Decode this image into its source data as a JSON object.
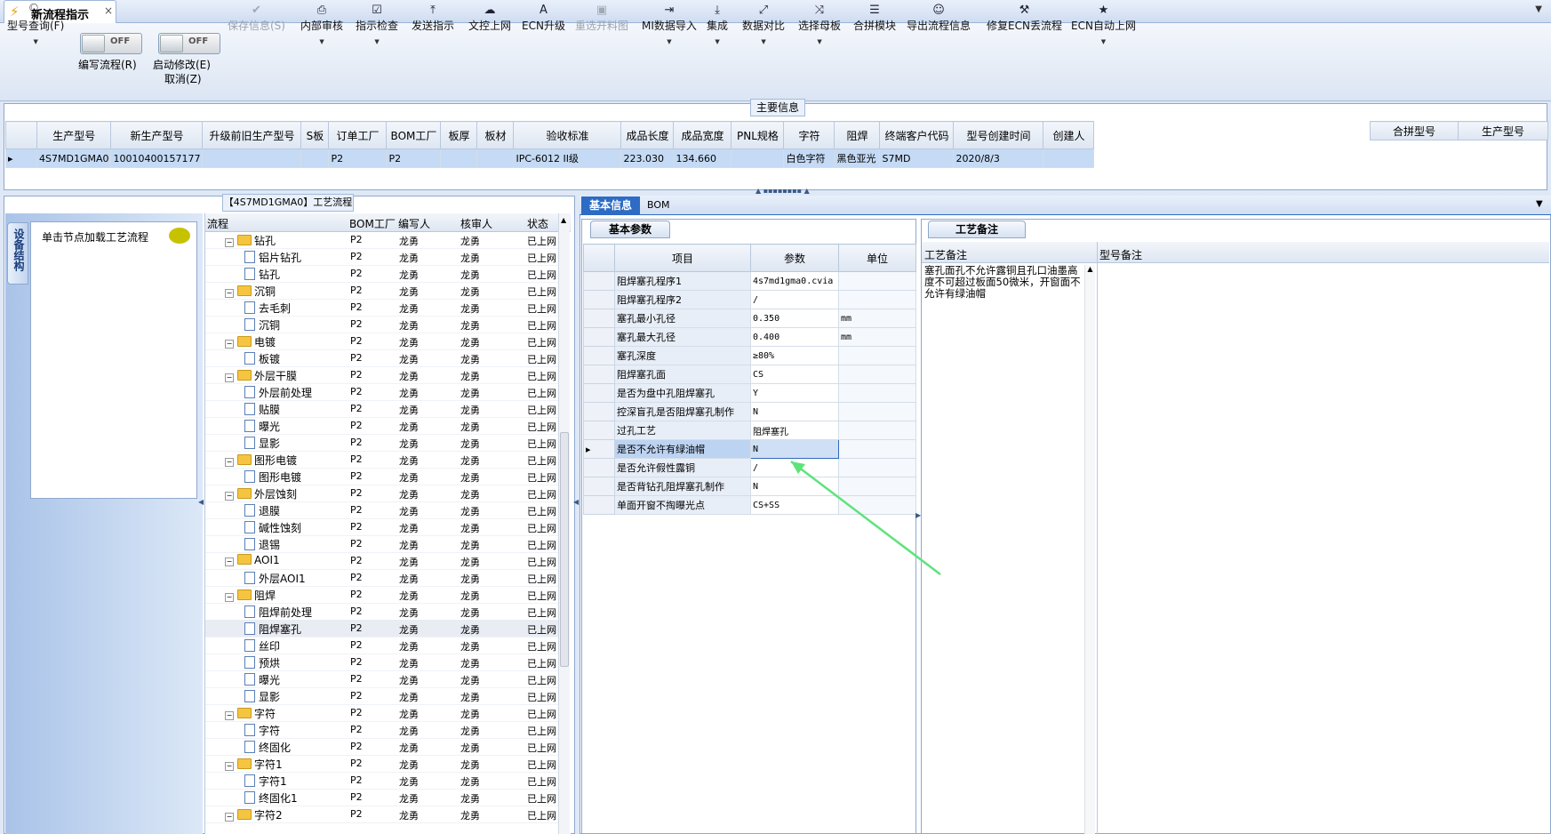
{
  "window": {
    "tab_title": "新流程指示",
    "close": "×"
  },
  "toolbar": {
    "items": [
      {
        "label": "型号查询(F)",
        "icon": "search-icon",
        "glyph": "🔍︎",
        "enabled": true,
        "dropdown": true
      },
      {
        "label": "保存信息(S)",
        "icon": "check-icon",
        "glyph": "✔",
        "enabled": false,
        "dropdown": false
      },
      {
        "label": "内部审核",
        "icon": "print-icon",
        "glyph": "⎙",
        "enabled": true,
        "dropdown": true
      },
      {
        "label": "指示检查",
        "icon": "checklist-icon",
        "glyph": "☑",
        "enabled": true,
        "dropdown": true
      },
      {
        "label": "发送指示",
        "icon": "upload-icon",
        "glyph": "⤒",
        "enabled": true,
        "dropdown": false
      },
      {
        "label": "文控上网",
        "icon": "cloud-icon",
        "glyph": "☁",
        "enabled": true,
        "dropdown": false
      },
      {
        "label": "ECN升级",
        "icon": "ecn-icon",
        "glyph": "A",
        "enabled": true,
        "dropdown": false
      },
      {
        "label": "重选开料图",
        "icon": "image-icon",
        "glyph": "▣",
        "enabled": false,
        "dropdown": false
      },
      {
        "label": "MI数据导入",
        "icon": "import-icon",
        "glyph": "⇥",
        "enabled": true,
        "dropdown": true
      },
      {
        "label": "集成",
        "icon": "download-icon",
        "glyph": "⤓",
        "enabled": true,
        "dropdown": true
      },
      {
        "label": "数据对比",
        "icon": "compare-icon",
        "glyph": "⤢",
        "enabled": true,
        "dropdown": true
      },
      {
        "label": "选择母板",
        "icon": "shuffle-icon",
        "glyph": "⤨",
        "enabled": true,
        "dropdown": true
      },
      {
        "label": "合拼模块",
        "icon": "list-icon",
        "glyph": "☰",
        "enabled": true,
        "dropdown": false
      },
      {
        "label": "导出流程信息",
        "icon": "smile-icon",
        "glyph": "☺",
        "enabled": true,
        "dropdown": false
      },
      {
        "label": "修复ECN丢流程",
        "icon": "wrench-icon",
        "glyph": "⚒",
        "enabled": true,
        "dropdown": false
      },
      {
        "label": "ECN自动上网",
        "icon": "star-icon",
        "glyph": "★",
        "enabled": true,
        "dropdown": true
      }
    ],
    "toggle_write": {
      "state": "OFF",
      "label": "编写流程(R)"
    },
    "toggle_modify": {
      "state": "OFF",
      "label": "启动修改(E)",
      "label2": "取消(Z)"
    }
  },
  "main_info": {
    "title": "主要信息",
    "columns": [
      "生产型号",
      "新生产型号",
      "升级前旧生产型号",
      "S板",
      "订单工厂",
      "BOM工厂",
      "板厚",
      "板材",
      "验收标准",
      "成品长度",
      "成品宽度",
      "PNL规格",
      "字符",
      "阻焊",
      "终端客户代码",
      "型号创建时间",
      "创建人"
    ],
    "row": [
      "4S7MD1GMA0",
      "10010400157177",
      "",
      "",
      "P2",
      "P2",
      "",
      "",
      "IPC-6012 II级",
      "223.030",
      "134.660",
      "",
      "白色字符",
      "黑色亚光",
      "S7MD",
      "2020/8/3",
      ""
    ],
    "merge_columns": [
      "合拼型号",
      "生产型号"
    ]
  },
  "process": {
    "title": "【4S7MD1GMA0】工艺流程",
    "side_tab": "设备结构",
    "load_hint": "单击节点加载工艺流程",
    "columns": [
      "流程",
      "BOM工厂",
      "编写人",
      "核审人",
      "状态"
    ],
    "rows": [
      {
        "name": "钻孔",
        "type": "folder",
        "bom": "P2",
        "writer": "龙勇",
        "reviewer": "龙勇",
        "status": "已上网"
      },
      {
        "name": "铝片钻孔",
        "type": "doc",
        "bom": "P2",
        "writer": "龙勇",
        "reviewer": "龙勇",
        "status": "已上网"
      },
      {
        "name": "钻孔",
        "type": "doc",
        "bom": "P2",
        "writer": "龙勇",
        "reviewer": "龙勇",
        "status": "已上网"
      },
      {
        "name": "沉铜",
        "type": "folder",
        "bom": "P2",
        "writer": "龙勇",
        "reviewer": "龙勇",
        "status": "已上网"
      },
      {
        "name": "去毛刺",
        "type": "doc",
        "bom": "P2",
        "writer": "龙勇",
        "reviewer": "龙勇",
        "status": "已上网"
      },
      {
        "name": "沉铜",
        "type": "doc",
        "bom": "P2",
        "writer": "龙勇",
        "reviewer": "龙勇",
        "status": "已上网"
      },
      {
        "name": "电镀",
        "type": "folder",
        "bom": "P2",
        "writer": "龙勇",
        "reviewer": "龙勇",
        "status": "已上网"
      },
      {
        "name": "板镀",
        "type": "doc",
        "bom": "P2",
        "writer": "龙勇",
        "reviewer": "龙勇",
        "status": "已上网"
      },
      {
        "name": "外层干膜",
        "type": "folder",
        "bom": "P2",
        "writer": "龙勇",
        "reviewer": "龙勇",
        "status": "已上网"
      },
      {
        "name": "外层前处理",
        "type": "doc",
        "bom": "P2",
        "writer": "龙勇",
        "reviewer": "龙勇",
        "status": "已上网"
      },
      {
        "name": "贴膜",
        "type": "doc",
        "bom": "P2",
        "writer": "龙勇",
        "reviewer": "龙勇",
        "status": "已上网"
      },
      {
        "name": "曝光",
        "type": "doc",
        "bom": "P2",
        "writer": "龙勇",
        "reviewer": "龙勇",
        "status": "已上网"
      },
      {
        "name": "显影",
        "type": "doc",
        "bom": "P2",
        "writer": "龙勇",
        "reviewer": "龙勇",
        "status": "已上网"
      },
      {
        "name": "图形电镀",
        "type": "folder",
        "bom": "P2",
        "writer": "龙勇",
        "reviewer": "龙勇",
        "status": "已上网"
      },
      {
        "name": "图形电镀",
        "type": "doc",
        "bom": "P2",
        "writer": "龙勇",
        "reviewer": "龙勇",
        "status": "已上网"
      },
      {
        "name": "外层蚀刻",
        "type": "folder",
        "bom": "P2",
        "writer": "龙勇",
        "reviewer": "龙勇",
        "status": "已上网"
      },
      {
        "name": "退膜",
        "type": "doc",
        "bom": "P2",
        "writer": "龙勇",
        "reviewer": "龙勇",
        "status": "已上网"
      },
      {
        "name": "碱性蚀刻",
        "type": "doc",
        "bom": "P2",
        "writer": "龙勇",
        "reviewer": "龙勇",
        "status": "已上网"
      },
      {
        "name": "退锡",
        "type": "doc",
        "bom": "P2",
        "writer": "龙勇",
        "reviewer": "龙勇",
        "status": "已上网"
      },
      {
        "name": "AOI1",
        "type": "folder",
        "bom": "P2",
        "writer": "龙勇",
        "reviewer": "龙勇",
        "status": "已上网"
      },
      {
        "name": "外层AOI1",
        "type": "doc",
        "bom": "P2",
        "writer": "龙勇",
        "reviewer": "龙勇",
        "status": "已上网"
      },
      {
        "name": "阻焊",
        "type": "folder",
        "bom": "P2",
        "writer": "龙勇",
        "reviewer": "龙勇",
        "status": "已上网"
      },
      {
        "name": "阻焊前处理",
        "type": "doc",
        "bom": "P2",
        "writer": "龙勇",
        "reviewer": "龙勇",
        "status": "已上网"
      },
      {
        "name": "阻焊塞孔",
        "type": "doc",
        "bom": "P2",
        "writer": "龙勇",
        "reviewer": "龙勇",
        "status": "已上网",
        "selected": true
      },
      {
        "name": "丝印",
        "type": "doc",
        "bom": "P2",
        "writer": "龙勇",
        "reviewer": "龙勇",
        "status": "已上网"
      },
      {
        "name": "预烘",
        "type": "doc",
        "bom": "P2",
        "writer": "龙勇",
        "reviewer": "龙勇",
        "status": "已上网"
      },
      {
        "name": "曝光",
        "type": "doc",
        "bom": "P2",
        "writer": "龙勇",
        "reviewer": "龙勇",
        "status": "已上网"
      },
      {
        "name": "显影",
        "type": "doc",
        "bom": "P2",
        "writer": "龙勇",
        "reviewer": "龙勇",
        "status": "已上网"
      },
      {
        "name": "字符",
        "type": "folder",
        "bom": "P2",
        "writer": "龙勇",
        "reviewer": "龙勇",
        "status": "已上网"
      },
      {
        "name": "字符",
        "type": "doc",
        "bom": "P2",
        "writer": "龙勇",
        "reviewer": "龙勇",
        "status": "已上网"
      },
      {
        "name": "终固化",
        "type": "doc",
        "bom": "P2",
        "writer": "龙勇",
        "reviewer": "龙勇",
        "status": "已上网"
      },
      {
        "name": "字符1",
        "type": "folder",
        "bom": "P2",
        "writer": "龙勇",
        "reviewer": "龙勇",
        "status": "已上网"
      },
      {
        "name": "字符1",
        "type": "doc",
        "bom": "P2",
        "writer": "龙勇",
        "reviewer": "龙勇",
        "status": "已上网"
      },
      {
        "name": "终固化1",
        "type": "doc",
        "bom": "P2",
        "writer": "龙勇",
        "reviewer": "龙勇",
        "status": "已上网"
      },
      {
        "name": "字符2",
        "type": "folder",
        "bom": "P2",
        "writer": "龙勇",
        "reviewer": "龙勇",
        "status": "已上网"
      }
    ]
  },
  "right": {
    "tabs": [
      "基本信息",
      "BOM"
    ],
    "basic_title": "基本参数",
    "columns": [
      "项目",
      "参数",
      "单位"
    ],
    "params": [
      {
        "item": "阻焊塞孔程序1",
        "value": "4s7md1gma0.cvia",
        "unit": ""
      },
      {
        "item": "阻焊塞孔程序2",
        "value": "/",
        "unit": ""
      },
      {
        "item": "塞孔最小孔径",
        "value": "0.350",
        "unit": "mm"
      },
      {
        "item": "塞孔最大孔径",
        "value": "0.400",
        "unit": "mm"
      },
      {
        "item": "塞孔深度",
        "value": "≥80%",
        "unit": ""
      },
      {
        "item": "阻焊塞孔面",
        "value": "CS",
        "unit": ""
      },
      {
        "item": "是否为盘中孔阻焊塞孔",
        "value": "Y",
        "unit": ""
      },
      {
        "item": "控深盲孔是否阻焊塞孔制作",
        "value": "N",
        "unit": ""
      },
      {
        "item": "过孔工艺",
        "value": "阻焊塞孔",
        "unit": ""
      },
      {
        "item": "是否不允许有绿油帽",
        "value": "N",
        "unit": "",
        "selected": true
      },
      {
        "item": "是否允许假性露铜",
        "value": "/",
        "unit": ""
      },
      {
        "item": "是否背钻孔阻焊塞孔制作",
        "value": "N",
        "unit": ""
      },
      {
        "item": "单面开窗不掏曝光点",
        "value": "CS+SS",
        "unit": ""
      }
    ],
    "remark_title": "工艺备注",
    "remark_columns": [
      "工艺备注",
      "型号备注"
    ],
    "remark_text": "塞孔面孔不允许露铜且孔口油墨高度不可超过板面50微米，开窗面不允许有绿油帽"
  },
  "colors": {
    "accent": "#2d6bc4",
    "annotation_arrow": "#5ee37a"
  }
}
